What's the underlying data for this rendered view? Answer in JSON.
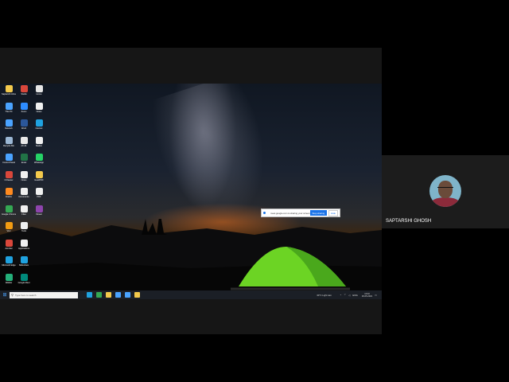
{
  "desktop_icons": [
    {
      "label": "Saptarshi Ghosh",
      "color": "#f3c94c",
      "col": 0,
      "row": 0
    },
    {
      "label": "This PC",
      "color": "#4aa3ff",
      "col": 0,
      "row": 1
    },
    {
      "label": "Network",
      "color": "#4aa3ff",
      "col": 0,
      "row": 2
    },
    {
      "label": "Recycle Bin",
      "color": "#9bb7d4",
      "col": 0,
      "row": 3
    },
    {
      "label": "Control Panel",
      "color": "#4aa3ff",
      "col": 0,
      "row": 4
    },
    {
      "label": "CCleaner",
      "color": "#d9473b",
      "col": 0,
      "row": 5
    },
    {
      "label": "Firefox",
      "color": "#ff8a1f",
      "col": 0,
      "row": 6
    },
    {
      "label": "Google Chrome",
      "color": "#34a853",
      "col": 0,
      "row": 7
    },
    {
      "label": "VLC",
      "color": "#f39c12",
      "col": 0,
      "row": 8
    },
    {
      "label": "Acrobat",
      "color": "#d9473b",
      "col": 0,
      "row": 9
    },
    {
      "label": "Microsoft Edge",
      "color": "#1fa2e0",
      "col": 0,
      "row": 10
    },
    {
      "label": "WebEx",
      "color": "#24b07a",
      "col": 0,
      "row": 11
    },
    {
      "label": "Studio",
      "color": "#d9473b",
      "col": 1,
      "row": 0
    },
    {
      "label": "Zoom",
      "color": "#2d8cff",
      "col": 1,
      "row": 1
    },
    {
      "label": "Word",
      "color": "#2b579a",
      "col": 1,
      "row": 2
    },
    {
      "label": "AK-01",
      "color": "#e8e8e8",
      "col": 1,
      "row": 3
    },
    {
      "label": "Excel",
      "color": "#217346",
      "col": 1,
      "row": 4
    },
    {
      "label": "Notes",
      "color": "#f0f0f0",
      "col": 1,
      "row": 5
    },
    {
      "label": "Documents",
      "color": "#f0f0f0",
      "col": 1,
      "row": 6
    },
    {
      "label": "Files",
      "color": "#f0f0f0",
      "col": 1,
      "row": 7
    },
    {
      "label": "Tools",
      "color": "#f0f0f0",
      "col": 1,
      "row": 8
    },
    {
      "label": "Applications",
      "color": "#f0f0f0",
      "col": 1,
      "row": 9
    },
    {
      "label": "Slideshare",
      "color": "#1fa2e0",
      "col": 1,
      "row": 10
    },
    {
      "label": "Google Meet",
      "color": "#00897b",
      "col": 1,
      "row": 11
    },
    {
      "label": "Home",
      "color": "#e6e6e6",
      "col": 2,
      "row": 0
    },
    {
      "label": "Notes",
      "color": "#f0f0f0",
      "col": 2,
      "row": 1
    },
    {
      "label": "Internet",
      "color": "#1fa2e0",
      "col": 2,
      "row": 2
    },
    {
      "label": "Station",
      "color": "#f0f0f0",
      "col": 2,
      "row": 3
    },
    {
      "label": "WhatsApp",
      "color": "#25d366",
      "col": 2,
      "row": 4
    },
    {
      "label": "GeekPDF",
      "color": "#f3c94c",
      "col": 2,
      "row": 5
    },
    {
      "label": "PDF",
      "color": "#f0f0f0",
      "col": 2,
      "row": 6
    },
    {
      "label": "Viewer",
      "color": "#8e44ad",
      "col": 2,
      "row": 7
    }
  ],
  "share_bar": {
    "message": "meet.google.com is sharing your screen.",
    "stop_label": "Stop sharing",
    "hide_label": "Hide"
  },
  "taskbar": {
    "search_placeholder": "Type here to search",
    "pinned": [
      {
        "name": "edge",
        "color": "#1fa2e0"
      },
      {
        "name": "chrome",
        "color": "#34a853"
      },
      {
        "name": "explorer",
        "color": "#f3c94c"
      },
      {
        "name": "store",
        "color": "#4aa3ff"
      },
      {
        "name": "mail",
        "color": "#4aa3ff"
      },
      {
        "name": "folder",
        "color": "#f3c94c"
      }
    ],
    "weather": "30°C Light rain",
    "lang": "ENG",
    "time": "13:40",
    "date": "30-05-2021"
  },
  "participant": {
    "name": "SAPTARSHI GHOSH"
  },
  "colors": {
    "accent": "#1a73e8",
    "panel": "#1c1c1c"
  }
}
